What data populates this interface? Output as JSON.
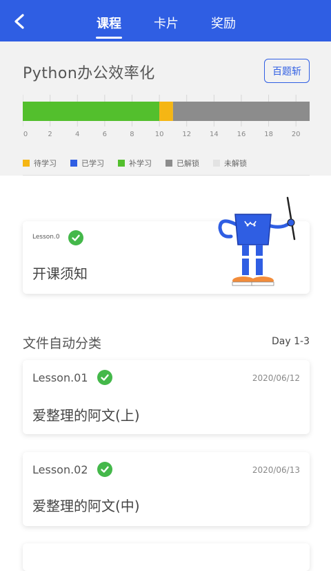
{
  "nav": {
    "tabs": [
      {
        "label": "课程",
        "active": true
      },
      {
        "label": "卡片",
        "active": false
      },
      {
        "label": "奖励",
        "active": false
      }
    ],
    "bar_color": "#2f5ee3"
  },
  "course": {
    "title": "Python办公效率化",
    "quiz_button": "百题斩"
  },
  "chart_data": {
    "type": "bar",
    "orientation": "horizontal",
    "stacked": true,
    "xlim": [
      0,
      21
    ],
    "xticks": [
      "0",
      "2",
      "4",
      "6",
      "8",
      "10",
      "12",
      "14",
      "16",
      "18",
      "20"
    ],
    "segments": [
      {
        "name": "补学习",
        "start": 0,
        "end": 10,
        "color": "#53bf2d"
      },
      {
        "name": "待学习",
        "start": 10,
        "end": 11,
        "color": "#f5b614"
      },
      {
        "name": "已解锁",
        "start": 11,
        "end": 21,
        "color": "#8c8c8c"
      }
    ],
    "legend": [
      {
        "name": "待学习",
        "color": "#f5b614"
      },
      {
        "name": "已学习",
        "color": "#2f5ee3"
      },
      {
        "name": "补学习",
        "color": "#53bf2d"
      },
      {
        "name": "已解锁",
        "color": "#8c8c8c"
      },
      {
        "name": "未解锁",
        "color": "#e3e3e3"
      }
    ],
    "legend_position": "bottom",
    "grid": true
  },
  "intro_card": {
    "lesson": "Lesson.0",
    "title": "开课须知"
  },
  "section": {
    "title": "文件自动分类",
    "day": "Day 1-3"
  },
  "lessons": [
    {
      "lesson": "Lesson.01",
      "date": "2020/06/12",
      "title": "爱整理的阿文(上)"
    },
    {
      "lesson": "Lesson.02",
      "date": "2020/06/13",
      "title": "爱整理的阿文(中)"
    }
  ],
  "status_color": "#44b84a"
}
